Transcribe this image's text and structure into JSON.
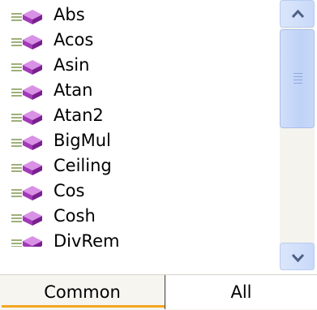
{
  "list": {
    "items": [
      {
        "label": "Abs",
        "icon": "method-icon"
      },
      {
        "label": "Acos",
        "icon": "method-icon"
      },
      {
        "label": "Asin",
        "icon": "method-icon"
      },
      {
        "label": "Atan",
        "icon": "method-icon"
      },
      {
        "label": "Atan2",
        "icon": "method-icon"
      },
      {
        "label": "BigMul",
        "icon": "method-icon"
      },
      {
        "label": "Ceiling",
        "icon": "method-icon"
      },
      {
        "label": "Cos",
        "icon": "method-icon"
      },
      {
        "label": "Cosh",
        "icon": "method-icon"
      },
      {
        "label": "DivRem",
        "icon": "method-icon"
      }
    ]
  },
  "tabs": [
    {
      "label": "Common",
      "active": true
    },
    {
      "label": "All",
      "active": false
    }
  ],
  "colors": {
    "icon_purple": "#b03fc8",
    "tab_accent": "#f5a623",
    "scrollbar_blue": "#c8d9f8"
  }
}
